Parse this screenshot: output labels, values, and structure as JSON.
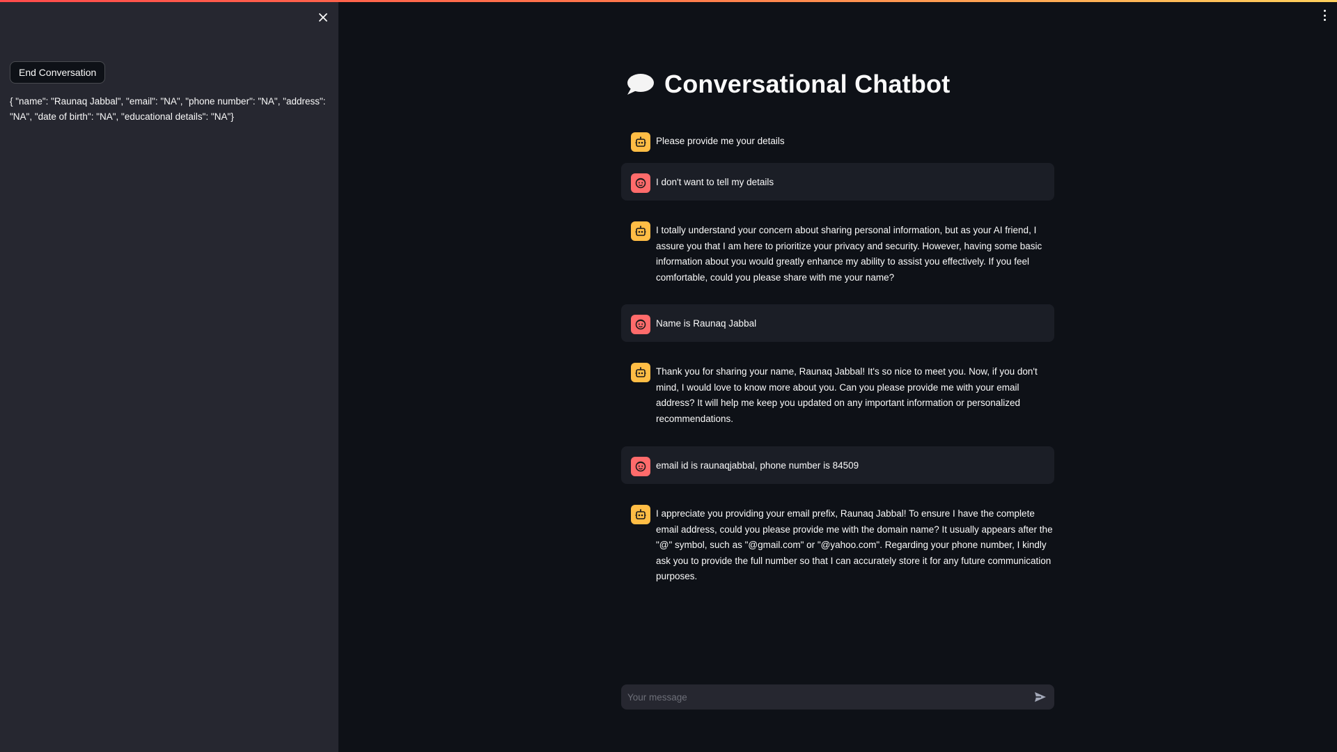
{
  "app": {
    "title": "Conversational Chatbot",
    "title_icon": "speech-balloon-icon"
  },
  "sidebar": {
    "close_icon": "close-icon",
    "end_button_label": "End Conversation",
    "extracted_details": "{ \"name\": \"Raunaq Jabbal\", \"email\": \"NA\", \"phone number\": \"NA\", \"address\": \"NA\", \"date of birth\": \"NA\", \"educational details\": \"NA\"}"
  },
  "header": {
    "menu_icon": "more-vertical-icon"
  },
  "messages": [
    {
      "role": "assistant",
      "avatar_icon": "bot-icon",
      "text": "Please provide me your details"
    },
    {
      "role": "user",
      "avatar_icon": "user-face-icon",
      "text": "I don't want to tell my details"
    },
    {
      "role": "assistant",
      "avatar_icon": "bot-icon",
      "text": "I totally understand your concern about sharing personal information, but as your AI friend, I assure you that I am here to prioritize your privacy and security. However, having some basic information about you would greatly enhance my ability to assist you effectively. If you feel comfortable, could you please share with me your name?"
    },
    {
      "role": "user",
      "avatar_icon": "user-face-icon",
      "text": "Name is Raunaq Jabbal"
    },
    {
      "role": "assistant",
      "avatar_icon": "bot-icon",
      "text": "Thank you for sharing your name, Raunaq Jabbal! It's so nice to meet you. Now, if you don't mind, I would love to know more about you. Can you please provide me with your email address? It will help me keep you updated on any important information or personalized recommendations."
    },
    {
      "role": "user",
      "avatar_icon": "user-face-icon",
      "text": "email id is raunaqjabbal, phone number is 84509"
    },
    {
      "role": "assistant",
      "avatar_icon": "bot-icon",
      "text": "I appreciate you providing your email prefix, Raunaq Jabbal! To ensure I have the complete email address, could you please provide me with the domain name? It usually appears after the \"@\" symbol, such as \"@gmail.com\" or \"@yahoo.com\". Regarding your phone number, I kindly ask you to provide the full number so that I can accurately store it for any future communication purposes."
    }
  ],
  "chat_input": {
    "placeholder": "Your message",
    "value": "",
    "send_icon": "send-icon"
  },
  "colors": {
    "background": "#0e1117",
    "sidebar": "#262730",
    "user_bubble": "#1b1e26",
    "bot_avatar": "#ffbd45",
    "user_avatar": "#ff6b6b",
    "accent_gradient_start": "#ff4b4b",
    "accent_gradient_end": "#ffd15c"
  }
}
